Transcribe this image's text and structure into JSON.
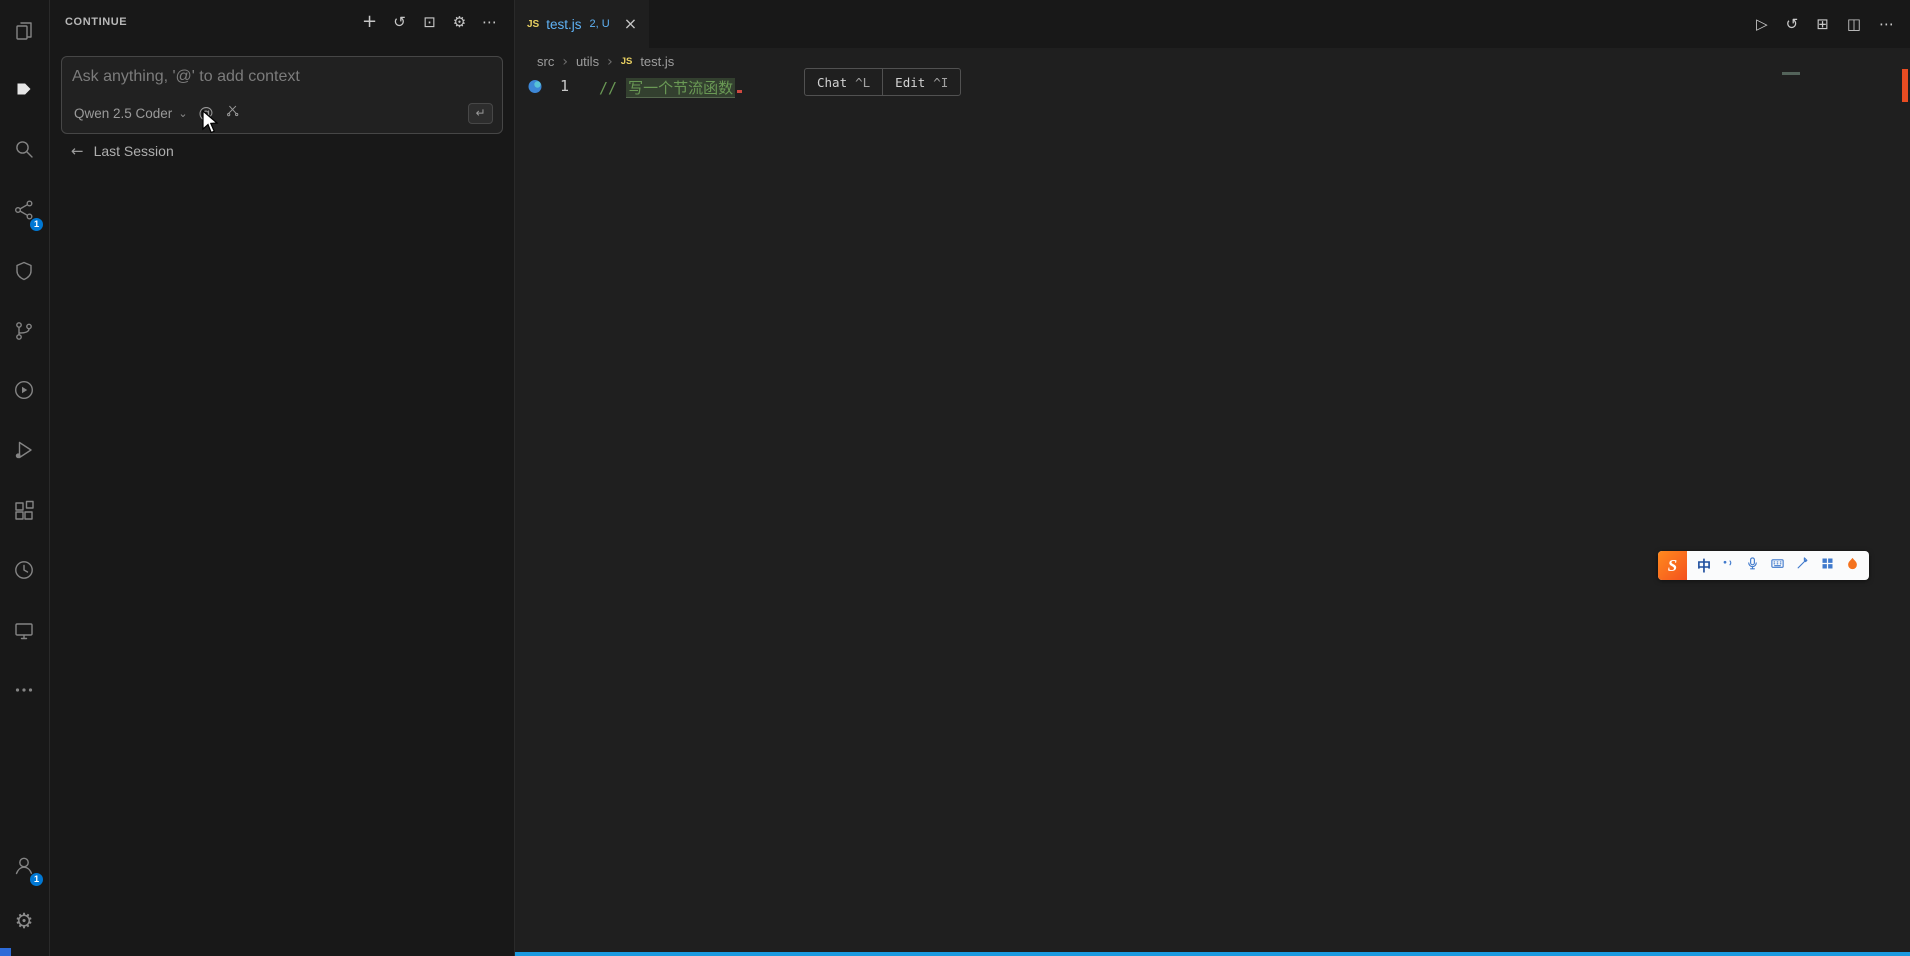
{
  "glyphs": {
    "add": "+",
    "history": "↺",
    "frame": "⊡",
    "gear": "⚙",
    "more": "⋯",
    "play": "▷",
    "split": "⊞",
    "layout": "◫",
    "close": "×",
    "crumb_sep": "›",
    "chevron_down": "⌄",
    "at": "@",
    "enter": "↵",
    "back": "←"
  },
  "colors": {
    "accent": "#0078d4",
    "comment_green": "#6a9955",
    "tab_file": "#5fb2f5",
    "modified_marker": "#e84c22",
    "bottom_strip": "#1b9ae0"
  },
  "activity_bar": {
    "items": [
      {
        "id": "explorer",
        "icon": "files-icon"
      },
      {
        "id": "continue",
        "icon": "continue-icon",
        "active": true
      },
      {
        "id": "search",
        "icon": "search-icon"
      },
      {
        "id": "chat-remote",
        "icon": "share-network-icon",
        "badge": "1"
      },
      {
        "id": "extension",
        "icon": "shield-icon"
      },
      {
        "id": "source-control",
        "icon": "git-branch-icon"
      },
      {
        "id": "run",
        "icon": "play-circle-icon"
      },
      {
        "id": "run-and-debug",
        "icon": "debug-play-icon"
      },
      {
        "id": "extensions",
        "icon": "extensions-icon"
      },
      {
        "id": "timeline",
        "icon": "clock-icon"
      },
      {
        "id": "remote-explorer",
        "icon": "monitor-icon"
      },
      {
        "id": "more-views",
        "icon": "ellipsis-icon"
      }
    ],
    "bottom": [
      {
        "id": "accounts",
        "icon": "person-icon",
        "badge": "1"
      },
      {
        "id": "settings",
        "icon": "gear-icon"
      }
    ]
  },
  "sidebar": {
    "title": "CONTINUE",
    "input": {
      "placeholder": "Ask anything, '@' to add context"
    },
    "model_selector": {
      "label": "Qwen 2.5 Coder"
    },
    "last_session_label": "Last Session"
  },
  "editor": {
    "tab": {
      "icon_text": "JS",
      "name": "test.js",
      "decorations": "2, U"
    },
    "breadcrumb": {
      "item1": "src",
      "item2": "utils",
      "file_icon": "JS",
      "item3": "test.js"
    },
    "code": {
      "line_number": "1",
      "comment_prefix": "//",
      "comment_text": "写一个节流函数"
    },
    "inline_widget": {
      "chat_label": "Chat",
      "chat_key": "^L",
      "edit_label": "Edit",
      "edit_key": "^I"
    }
  },
  "ime": {
    "logo_text": "S",
    "mode_label": "中"
  }
}
